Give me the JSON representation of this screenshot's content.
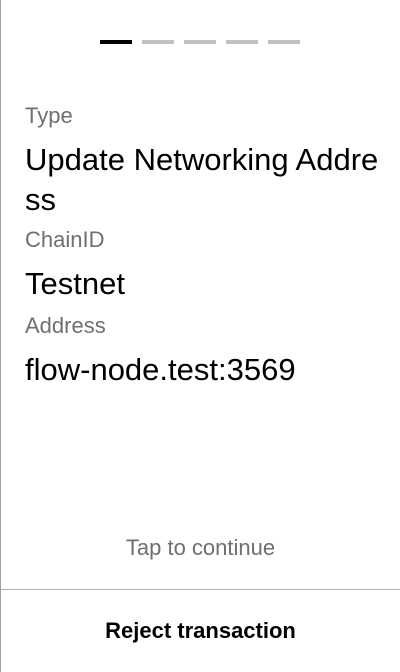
{
  "pager": {
    "total": 5,
    "current": 1
  },
  "fields": {
    "type": {
      "label": "Type",
      "value": "Update Networking Address"
    },
    "chain_id": {
      "label": "ChainID",
      "value": "Testnet"
    },
    "address": {
      "label": "Address",
      "value": "flow-node.test:3569"
    }
  },
  "hint": "Tap to continue",
  "actions": {
    "reject_label": "Reject transaction"
  },
  "colors": {
    "pager_active": "#000000",
    "pager_inactive": "#c0c0c0",
    "label_text": "#6f6f6f",
    "value_text": "#000000"
  }
}
